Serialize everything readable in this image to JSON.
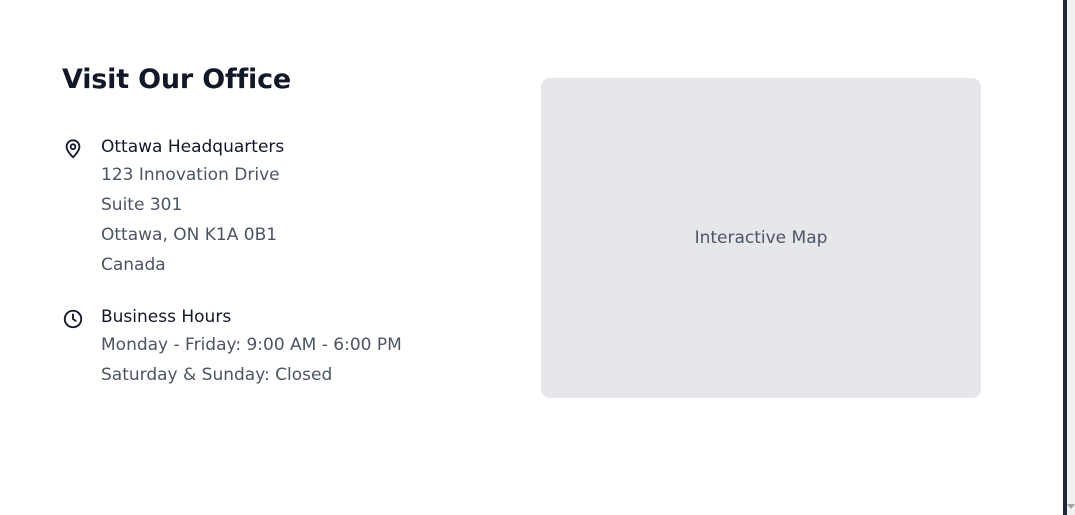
{
  "section": {
    "title": "Visit Our Office"
  },
  "address": {
    "icon": "map-pin-icon",
    "heading": "Ottawa Headquarters",
    "lines": [
      "123 Innovation Drive",
      "Suite 301",
      "Ottawa, ON K1A 0B1",
      "Canada"
    ]
  },
  "hours": {
    "icon": "clock-icon",
    "heading": "Business Hours",
    "lines": [
      "Monday - Friday: 9:00 AM - 6:00 PM",
      "Saturday & Sunday: Closed"
    ]
  },
  "map": {
    "label": "Interactive Map"
  },
  "colors": {
    "heading": "#111827",
    "body_text": "#4b5563",
    "map_background": "#e5e7eb",
    "page_background": "#ffffff"
  }
}
